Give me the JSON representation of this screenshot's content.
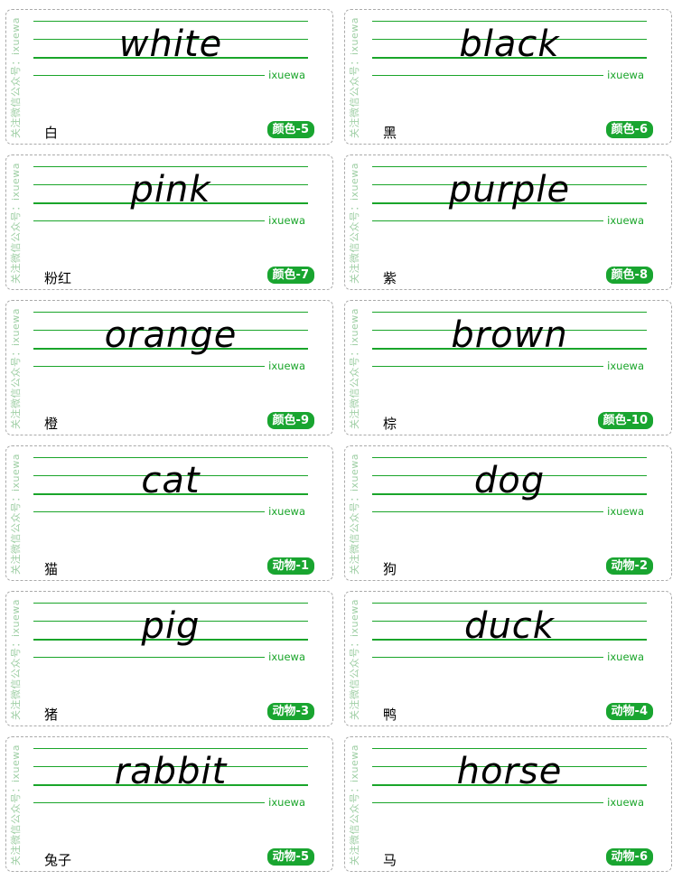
{
  "side_text": "关注微信公众号：ixuewa",
  "brand": "ixuewa",
  "accent": "#1aa52a",
  "cards": [
    {
      "word": "white",
      "cn": "白",
      "tag": "颜色-5"
    },
    {
      "word": "black",
      "cn": "黑",
      "tag": "颜色-6"
    },
    {
      "word": "pink",
      "cn": "粉红",
      "tag": "颜色-7"
    },
    {
      "word": "purple",
      "cn": "紫",
      "tag": "颜色-8"
    },
    {
      "word": "orange",
      "cn": "橙",
      "tag": "颜色-9"
    },
    {
      "word": "brown",
      "cn": "棕",
      "tag": "颜色-10"
    },
    {
      "word": "cat",
      "cn": "猫",
      "tag": "动物-1"
    },
    {
      "word": "dog",
      "cn": "狗",
      "tag": "动物-2"
    },
    {
      "word": "pig",
      "cn": "猪",
      "tag": "动物-3"
    },
    {
      "word": "duck",
      "cn": "鸭",
      "tag": "动物-4"
    },
    {
      "word": "rabbit",
      "cn": "兔子",
      "tag": "动物-5"
    },
    {
      "word": "horse",
      "cn": "马",
      "tag": "动物-6"
    }
  ]
}
